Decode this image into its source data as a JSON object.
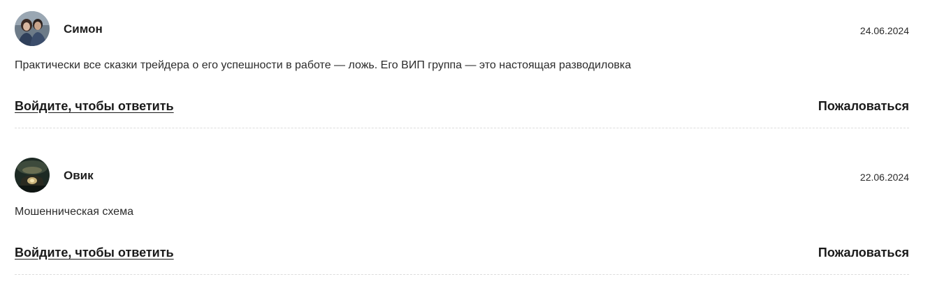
{
  "comments": [
    {
      "author": "Симон",
      "date": "24.06.2024",
      "text": "Практически все сказки трейдера о его успешности в работе — ложь. Его ВИП группа — это настоящая разводиловка",
      "reply_label": "Войдите, чтобы ответить",
      "report_label": "Пожаловаться",
      "avatar_icon": "user-photo-couple"
    },
    {
      "author": "Овик",
      "date": "22.06.2024",
      "text": "Мошенническая схема",
      "reply_label": "Войдите, чтобы ответить",
      "report_label": "Пожаловаться",
      "avatar_icon": "user-photo-dark"
    }
  ],
  "colors": {
    "text": "#1f1f1f",
    "divider": "#dcdcdc",
    "background": "#ffffff"
  }
}
